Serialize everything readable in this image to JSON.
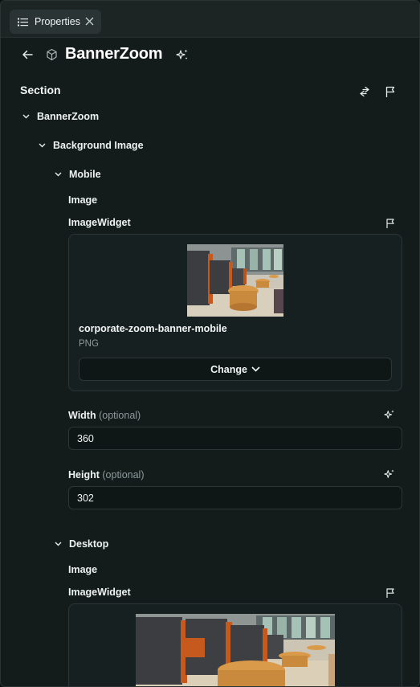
{
  "tab": {
    "label": "Properties"
  },
  "header": {
    "title": "BannerZoom"
  },
  "section": {
    "label": "Section"
  },
  "tree": {
    "root": "BannerZoom",
    "background": "Background Image",
    "mobile": "Mobile",
    "desktop": "Desktop"
  },
  "mobile": {
    "image_label": "Image",
    "widget_label": "ImageWidget",
    "file_name": "corporate-zoom-banner-mobile",
    "file_type": "PNG",
    "change_label": "Change",
    "width_label": "Width",
    "width_optional": "(optional)",
    "width_value": "360",
    "height_label": "Height",
    "height_optional": "(optional)",
    "height_value": "302"
  },
  "desktop": {
    "image_label": "Image",
    "widget_label": "ImageWidget"
  },
  "colors": {
    "background": "#141b1b",
    "panel": "#172020",
    "border": "#2c3636",
    "text": "#eef2f2",
    "muted": "#8e9a9a",
    "chair_fabric": "#3b3d41",
    "chair_wood": "#c65a1e",
    "table_wood": "#d99a4a"
  }
}
